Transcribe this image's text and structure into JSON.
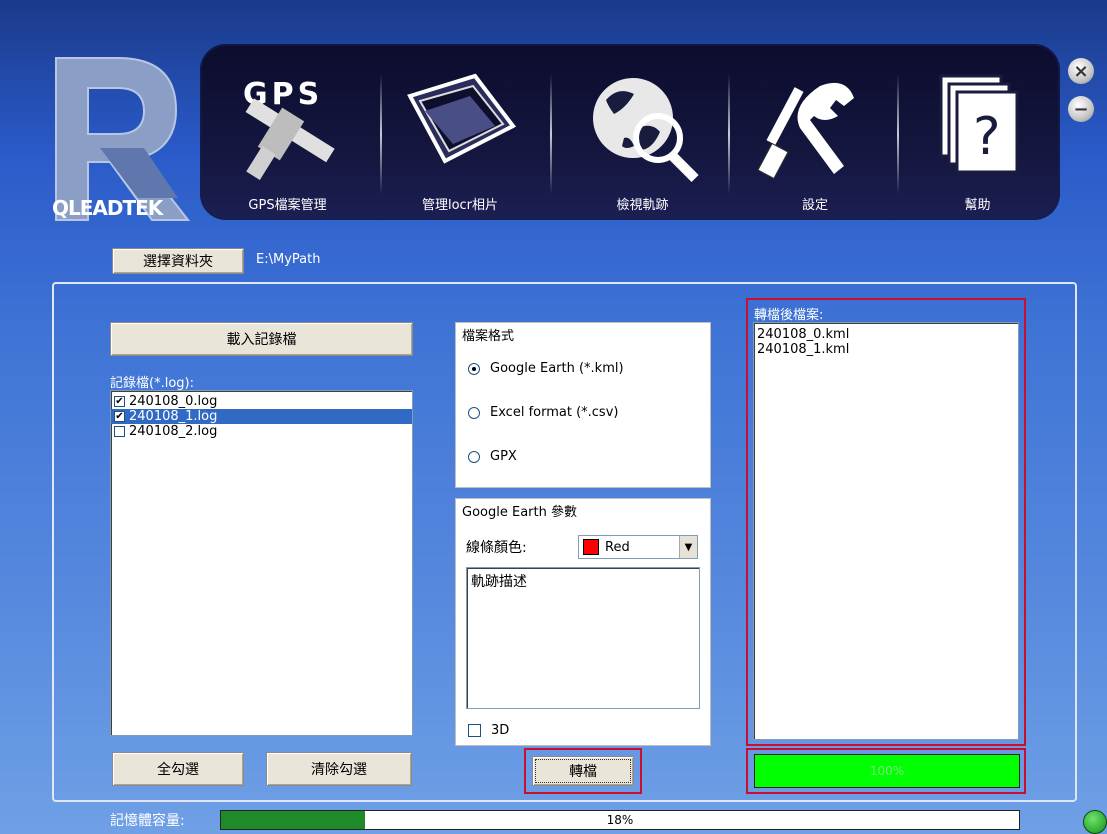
{
  "brand": {
    "logo_text": "QLEADTEK"
  },
  "nav": {
    "items": [
      {
        "label": "GPS檔案管理",
        "icon": "gps-satellite-icon"
      },
      {
        "label": "管理locr相片",
        "icon": "photo-frame-icon"
      },
      {
        "label": "檢視軌跡",
        "icon": "globe-magnifier-icon"
      },
      {
        "label": "設定",
        "icon": "wrench-screwdriver-icon"
      },
      {
        "label": "幫助",
        "icon": "help-documents-icon"
      }
    ]
  },
  "window_controls": {
    "close": "×",
    "minimize": "−"
  },
  "folder": {
    "button_label": "選擇資料夾",
    "path": "E:\\MyPath"
  },
  "log_panel": {
    "load_button": "載入記錄檔",
    "list_label": "記錄檔(*.log):",
    "files": [
      {
        "name": "240108_0.log",
        "checked": "✔"
      },
      {
        "name": "240108_1.log",
        "checked": "✔"
      },
      {
        "name": "240108_2.log",
        "checked": ""
      }
    ],
    "select_all": "全勾選",
    "clear_all": "清除勾選"
  },
  "format_group": {
    "title": "檔案格式",
    "options": [
      {
        "label": "Google Earth (*.kml)",
        "selected": true
      },
      {
        "label": "Excel format (*.csv)",
        "selected": false
      },
      {
        "label": "GPX",
        "selected": false
      }
    ]
  },
  "earth_group": {
    "title": "Google Earth 參數",
    "color_label": "線條顏色:",
    "color_value": "Red",
    "color_hex": "#ff0000",
    "description": "軌跡描述",
    "checkbox_3d": "3D"
  },
  "convert_button": "轉檔",
  "output_panel": {
    "label": "轉檔後檔案:",
    "files": [
      "240108_0.kml",
      "240108_1.kml"
    ],
    "progress_text": "100%",
    "progress_value": 1.0
  },
  "memory": {
    "label": "記憶體容量:",
    "value_text": "18%",
    "value": 0.18
  },
  "colors": {
    "accent_red": "#c8102e",
    "progress_green": "#00ff00",
    "memory_green": "#1f8a2a"
  }
}
